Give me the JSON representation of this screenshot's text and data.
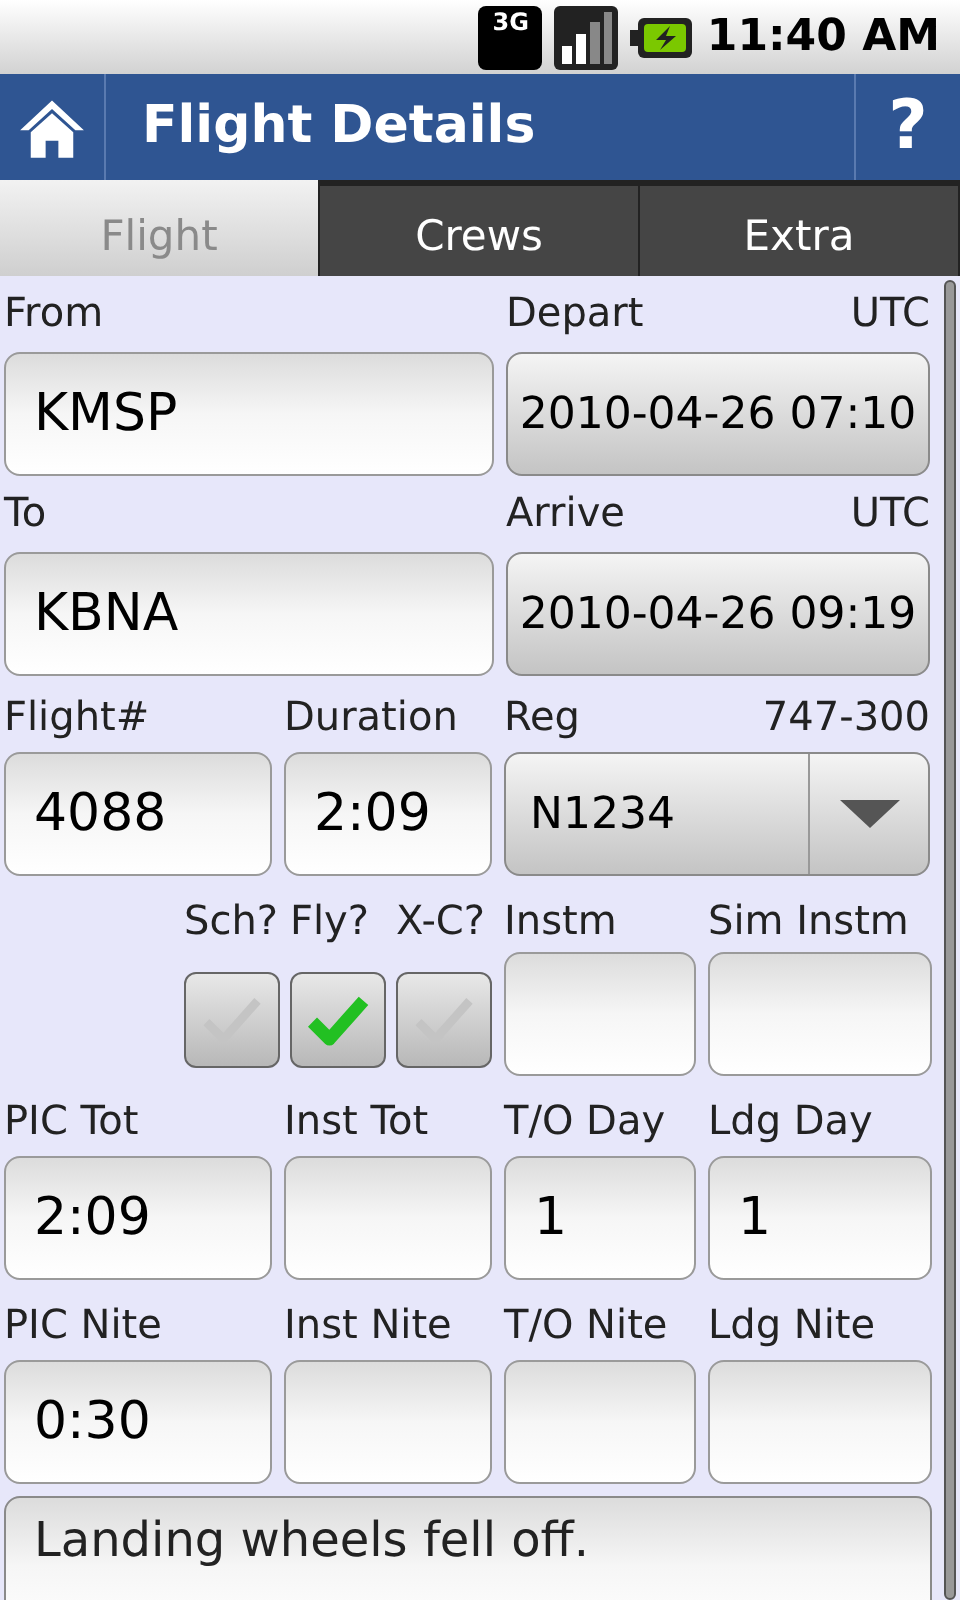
{
  "status_bar": {
    "network": "3G",
    "time": "11:40 AM"
  },
  "header": {
    "title": "Flight Details",
    "help": "?"
  },
  "tabs": [
    {
      "label": "Flight",
      "selected": true
    },
    {
      "label": "Crews",
      "selected": false
    },
    {
      "label": "Extra",
      "selected": false
    }
  ],
  "legs": [
    {
      "label": "From",
      "value": "KMSP",
      "time_label": "Depart",
      "zone": "UTC",
      "time": "2010-04-26 07:10"
    },
    {
      "label": "To",
      "value": "KBNA",
      "time_label": "Arrive",
      "zone": "UTC",
      "time": "2010-04-26 09:19"
    }
  ],
  "flight": {
    "number_label": "Flight#",
    "number": "4088",
    "duration_label": "Duration",
    "duration": "2:09",
    "reg_label": "Reg",
    "aircraft_type": "747-300",
    "reg": "N1234"
  },
  "checks": [
    {
      "label": "Sch?",
      "checked": false
    },
    {
      "label": "Fly?",
      "checked": true
    },
    {
      "label": "X-C?",
      "checked": false
    }
  ],
  "instrument_fields": [
    {
      "label": "Instm"
    },
    {
      "label": "Sim Instm"
    }
  ],
  "time_rows": [
    [
      {
        "label": "PIC Tot",
        "value": "2:09"
      },
      {
        "label": "Inst Tot"
      },
      {
        "label": "T/O Day",
        "value": "1"
      },
      {
        "label": "Ldg Day",
        "value": "1"
      }
    ],
    [
      {
        "label": "PIC Nite",
        "value": "0:30"
      },
      {
        "label": "Inst Nite"
      },
      {
        "label": "T/O Nite"
      },
      {
        "label": "Ldg Nite"
      }
    ]
  ],
  "notes": "Landing wheels fell off."
}
